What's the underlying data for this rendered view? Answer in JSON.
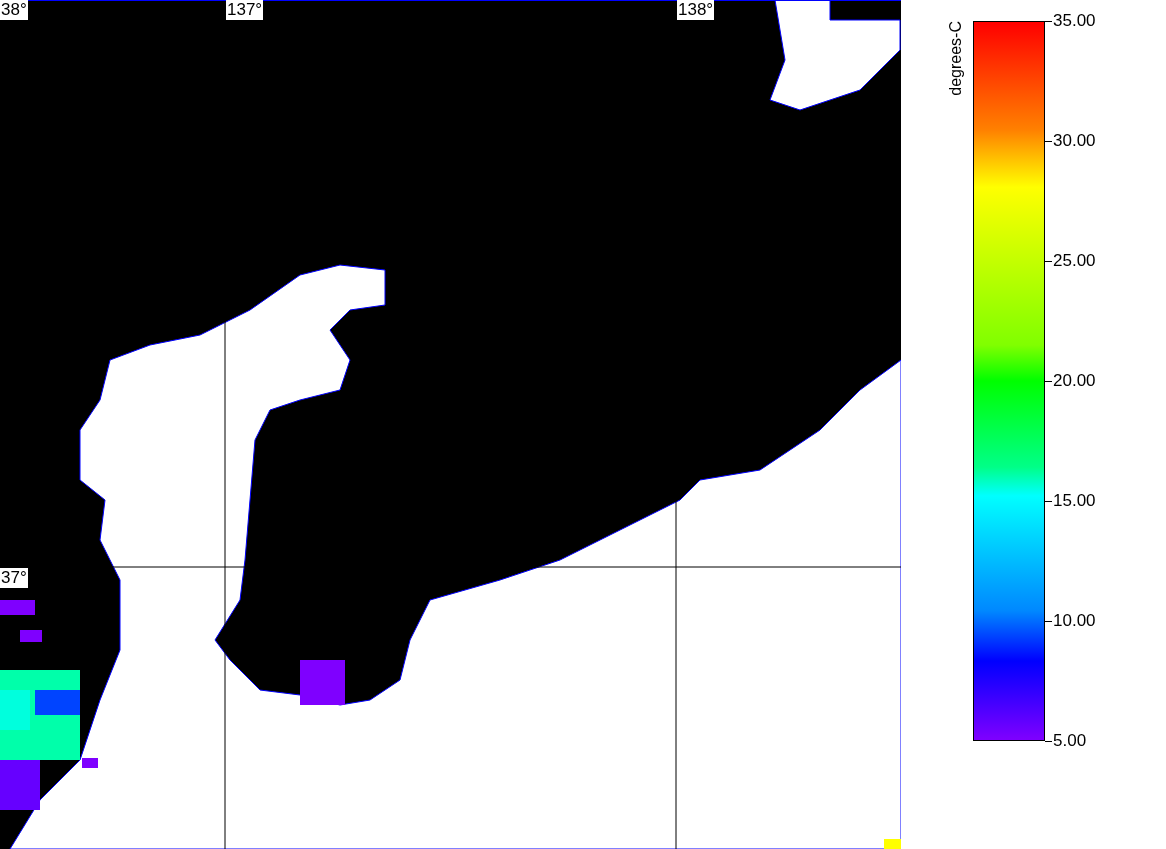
{
  "map": {
    "latitude_labels": [
      "38°",
      "37°"
    ],
    "longitude_labels": [
      "137°",
      "138°"
    ]
  },
  "legend": {
    "title": "degrees-C",
    "ticks": [
      "35.00",
      "30.00",
      "25.00",
      "20.00",
      "15.00",
      "10.00",
      "5.00"
    ]
  }
}
